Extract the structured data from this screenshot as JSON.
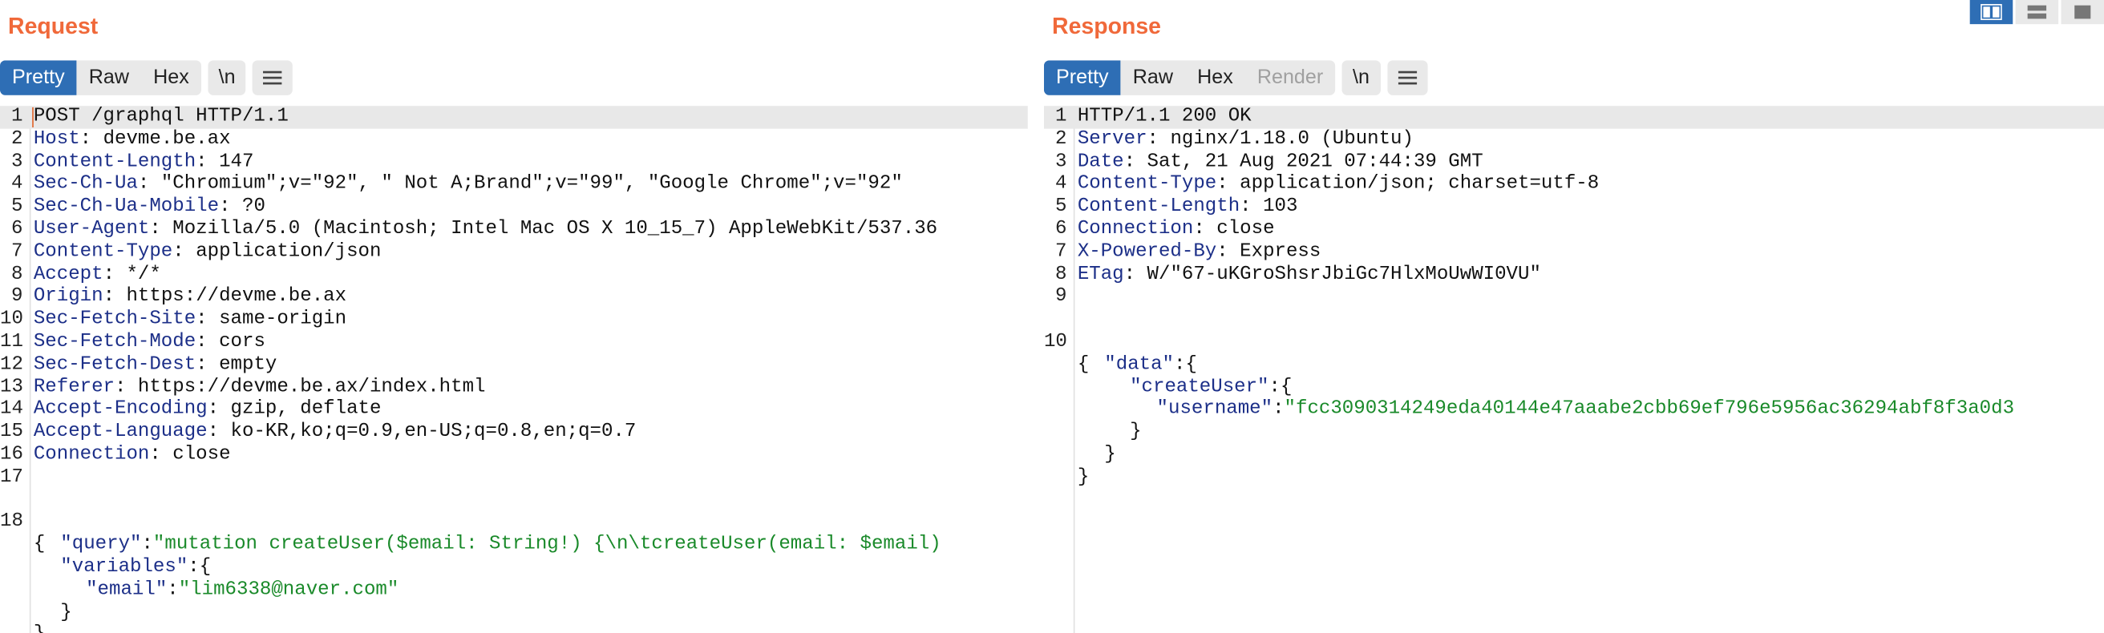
{
  "request": {
    "title": "Request",
    "tabs": [
      "Pretty",
      "Raw",
      "Hex"
    ],
    "newline_btn": "\\n",
    "lines": [
      {
        "n": "1",
        "key": "",
        "value": "POST /graphql HTTP/1.1"
      },
      {
        "n": "2",
        "key": "Host",
        "value": " devme.be.ax"
      },
      {
        "n": "3",
        "key": "Content-Length",
        "value": " 147"
      },
      {
        "n": "4",
        "key": "Sec-Ch-Ua",
        "value": " \"Chromium\";v=\"92\", \" Not A;Brand\";v=\"99\", \"Google Chrome\";v=\"92\""
      },
      {
        "n": "5",
        "key": "Sec-Ch-Ua-Mobile",
        "value": " ?0"
      },
      {
        "n": "6",
        "key": "User-Agent",
        "value": " Mozilla/5.0 (Macintosh; Intel Mac OS X 10_15_7) AppleWebKit/537.36"
      },
      {
        "n": "7",
        "key": "Content-Type",
        "value": " application/json"
      },
      {
        "n": "8",
        "key": "Accept",
        "value": " */*"
      },
      {
        "n": "9",
        "key": "Origin",
        "value": " https://devme.be.ax"
      },
      {
        "n": "10",
        "key": "Sec-Fetch-Site",
        "value": " same-origin"
      },
      {
        "n": "11",
        "key": "Sec-Fetch-Mode",
        "value": " cors"
      },
      {
        "n": "12",
        "key": "Sec-Fetch-Dest",
        "value": " empty"
      },
      {
        "n": "13",
        "key": "Referer",
        "value": " https://devme.be.ax/index.html"
      },
      {
        "n": "14",
        "key": "Accept-Encoding",
        "value": " gzip, deflate"
      },
      {
        "n": "15",
        "key": "Accept-Language",
        "value": " ko-KR,ko;q=0.9,en-US;q=0.8,en;q=0.7"
      },
      {
        "n": "16",
        "key": "Connection",
        "value": " close"
      },
      {
        "n": "17",
        "key": "",
        "value": ""
      }
    ],
    "body": {
      "line_number": "18",
      "open": "{",
      "query_key": "\"query\"",
      "query_value": "\"mutation createUser($email: String!) {\\n\\tcreateUser(email: $email)",
      "variables_key": "\"variables\"",
      "email_key": "\"email\"",
      "email_value": "\"lim6338@naver.com\"",
      "close_inner": "}",
      "close": "}"
    }
  },
  "response": {
    "title": "Response",
    "tabs": [
      "Pretty",
      "Raw",
      "Hex",
      "Render"
    ],
    "newline_btn": "\\n",
    "lines": [
      {
        "n": "1",
        "key": "",
        "value": "HTTP/1.1 200 OK"
      },
      {
        "n": "2",
        "key": "Server",
        "value": " nginx/1.18.0 (Ubuntu)"
      },
      {
        "n": "3",
        "key": "Date",
        "value": " Sat, 21 Aug 2021 07:44:39 GMT"
      },
      {
        "n": "4",
        "key": "Content-Type",
        "value": " application/json; charset=utf-8"
      },
      {
        "n": "5",
        "key": "Content-Length",
        "value": " 103"
      },
      {
        "n": "6",
        "key": "Connection",
        "value": " close"
      },
      {
        "n": "7",
        "key": "X-Powered-By",
        "value": " Express"
      },
      {
        "n": "8",
        "key": "ETag",
        "value": " W/\"67-uKGroShsrJbiGc7HlxMoUwWI0VU\""
      },
      {
        "n": "9",
        "key": "",
        "value": ""
      }
    ],
    "body": {
      "line_number": "10",
      "open": "{",
      "data_key": "\"data\"",
      "create_key": "\"createUser\"",
      "username_key": "\"username\"",
      "username_value": "\"fcc3090314249eda40144e47aaabe2cbb69ef796e5956ac36294abf8f3a0d3",
      "close_create": "}",
      "close_data": "}",
      "close": "}"
    }
  },
  "colors": {
    "accent": "#f0693a",
    "tab_active": "#2e6eb5",
    "header_key": "#1c2f88",
    "json_string": "#1a8a2a"
  }
}
